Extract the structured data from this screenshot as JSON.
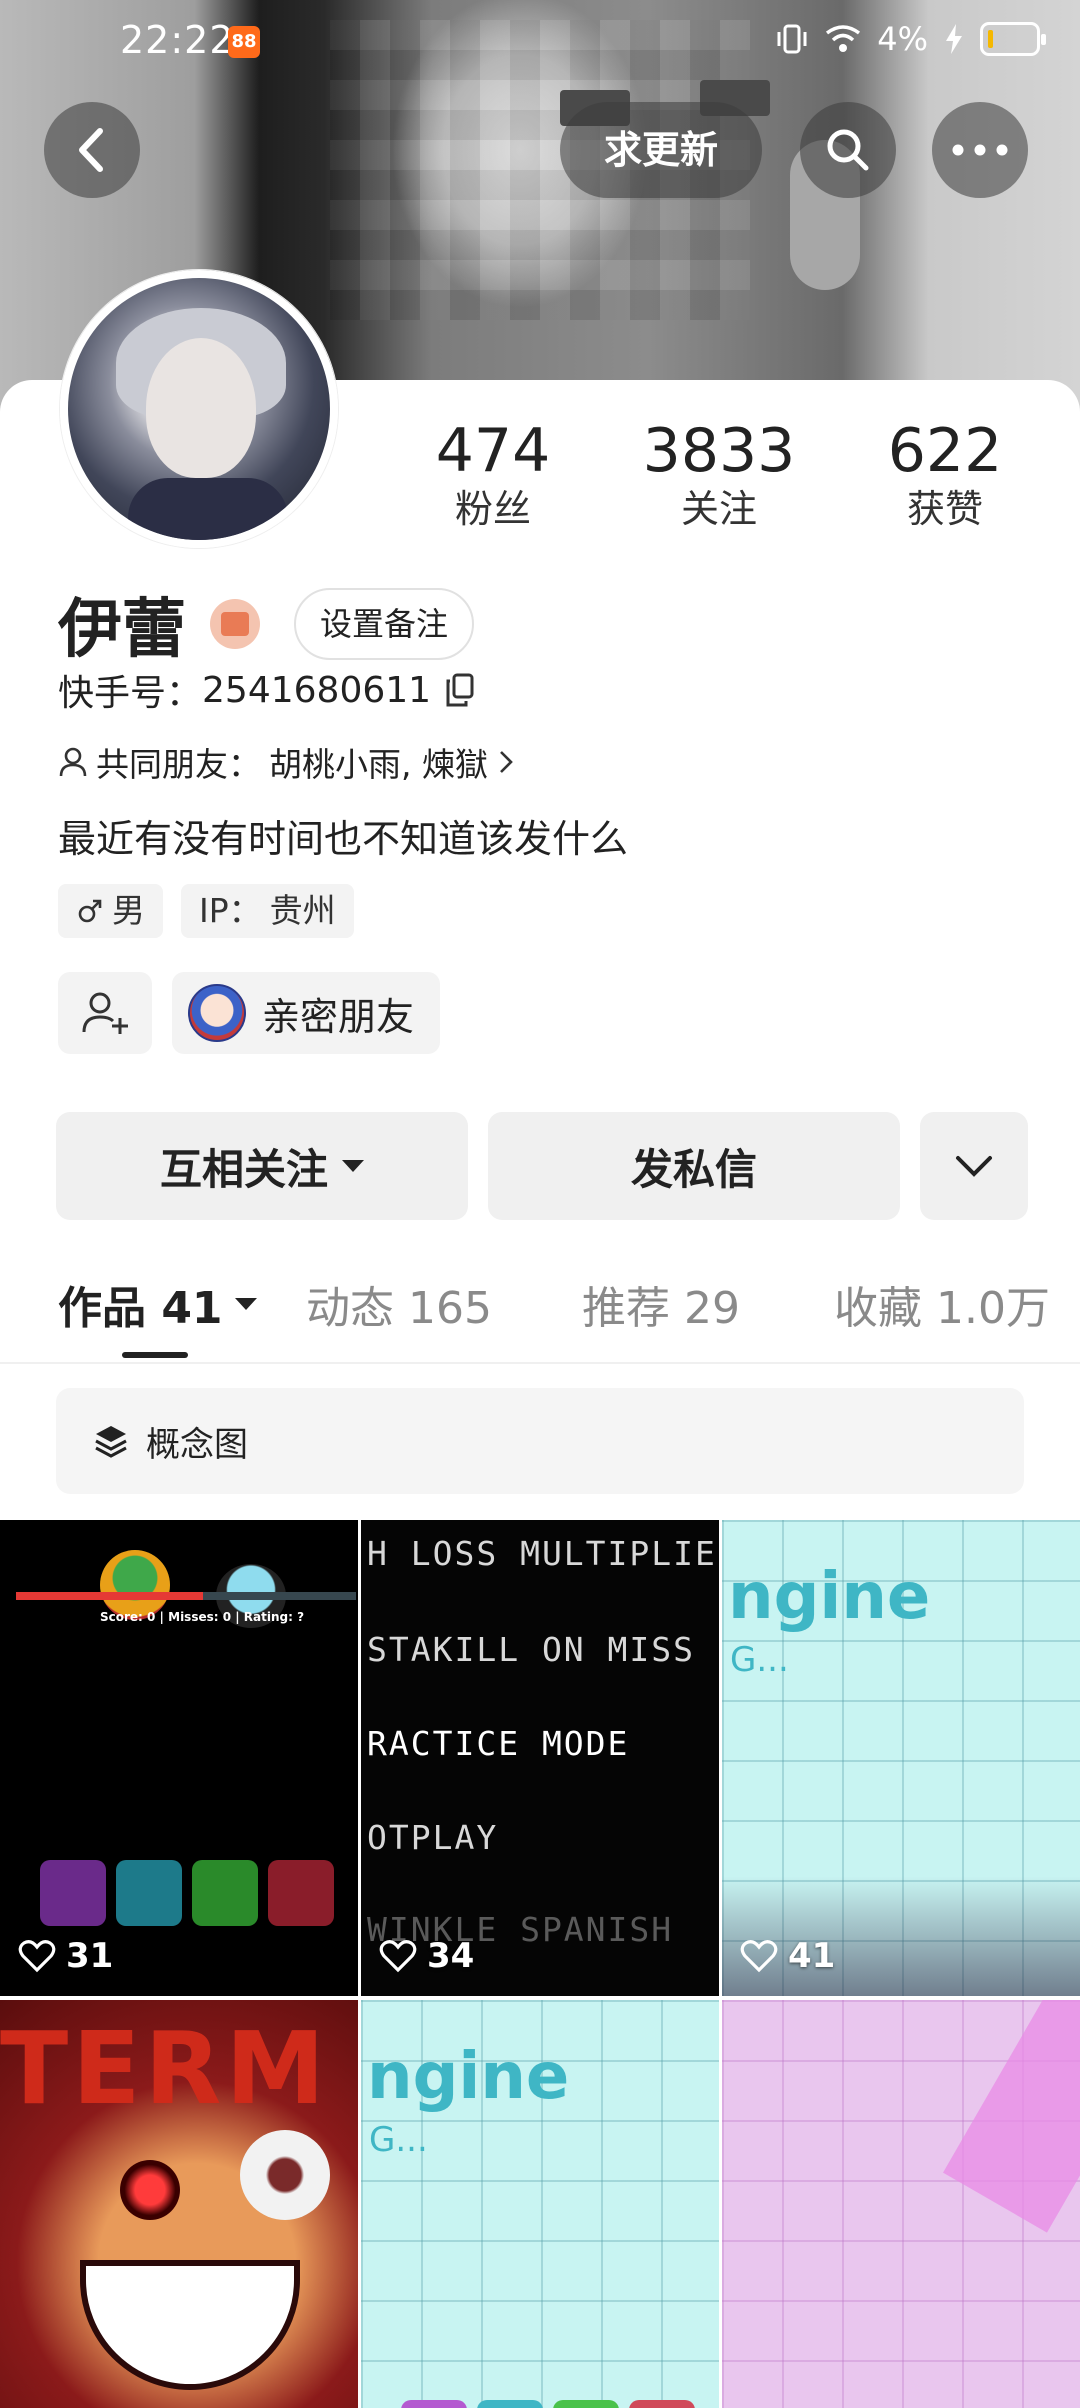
{
  "status_bar": {
    "time": "22:22",
    "app_badge": "88",
    "battery_percent": "4%"
  },
  "header": {
    "request_update_label": "求更新"
  },
  "profile": {
    "name": "伊蕾",
    "remark_button": "设置备注",
    "kuaishou_id_label": "快手号：",
    "kuaishou_id": "2541680611",
    "mutual_friends_label": "共同朋友：",
    "mutual_friends": "胡桃小雨, 煉獄",
    "bio": "最近有没有时间也不知道该发什么",
    "gender": "男",
    "ip_label": "IP：",
    "ip_location": "贵州",
    "close_friend_label": "亲密朋友"
  },
  "stats": [
    {
      "value": "474",
      "label": "粉丝"
    },
    {
      "value": "3833",
      "label": "关注"
    },
    {
      "value": "622",
      "label": "获赞"
    }
  ],
  "actions": {
    "follow_label": "互相关注",
    "message_label": "发私信"
  },
  "tabs": [
    {
      "label": "作品 41",
      "active": true
    },
    {
      "label": "动态 165",
      "active": false
    },
    {
      "label": "推荐 29",
      "active": false
    },
    {
      "label": "收藏 1.0万",
      "active": false
    }
  ],
  "collection": {
    "label": "概念图"
  },
  "grid": [
    {
      "likes": "31",
      "text": "Score: 0 | Misses: 0 | Rating: ?"
    },
    {
      "likes": "34",
      "lines": [
        "H LOSS MULTIPLIER",
        "STAKILL ON MISS",
        "RACTICE MODE",
        "OTPLAY",
        "WINKLE SPANISH"
      ]
    },
    {
      "likes": "41",
      "title": "ngine",
      "sub": "G..."
    },
    {
      "likes": "",
      "title": "TERM"
    },
    {
      "likes": "",
      "title": "ngine",
      "sub": "G..."
    },
    {
      "likes": ""
    }
  ],
  "colors": {
    "accent": "#222222",
    "tag_bg": "#f3f3f3",
    "badge": "#ff6a1a"
  }
}
